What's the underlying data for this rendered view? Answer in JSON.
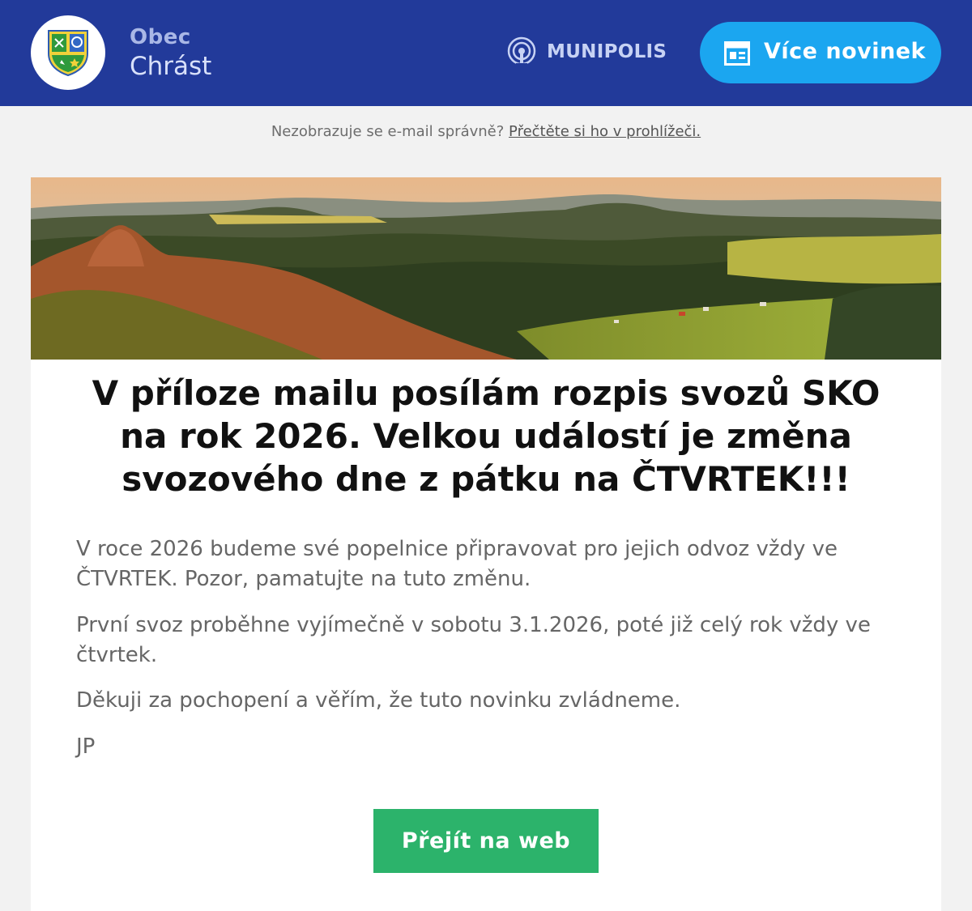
{
  "header": {
    "logo_icon": "municipal-coat-of-arms-icon",
    "town_prefix": "Obec",
    "town_name": "Chrást",
    "brand_icon": "broadcast-icon",
    "brand_name": "MUNIPOLIS",
    "more_news_icon": "newspaper-icon",
    "more_news_label": "Více novinek"
  },
  "notice": {
    "text": "Nezobrazuje se e-mail správně?",
    "link_label": "Přečtěte si ho v prohlížeči."
  },
  "article": {
    "banner_image": "landscape-banner",
    "headline": "V příloze mailu posílám rozpis svozů SKO na rok 2026. Velkou událostí je změna svozového dne z pátku na ČTVRTEK!!!",
    "paragraphs": [
      "V roce 2026 budeme své popelnice připravovat pro jejich odvoz vždy ve ČTVRTEK. Pozor, pamatujte na tuto změnu.",
      "První svoz proběhne vyjímečně v sobotu 3.1.2026, poté již celý rok vždy ve čtvrtek.",
      "Děkuji za pochopení a věřím, že tuto novinku zvládneme.",
      "JP"
    ],
    "cta_label": "Přejít na web"
  },
  "colors": {
    "header_bg": "#223a9a",
    "more_news_bg": "#1ba6f0",
    "cta_bg": "#2cb36b",
    "page_bg": "#f2f2f2"
  }
}
